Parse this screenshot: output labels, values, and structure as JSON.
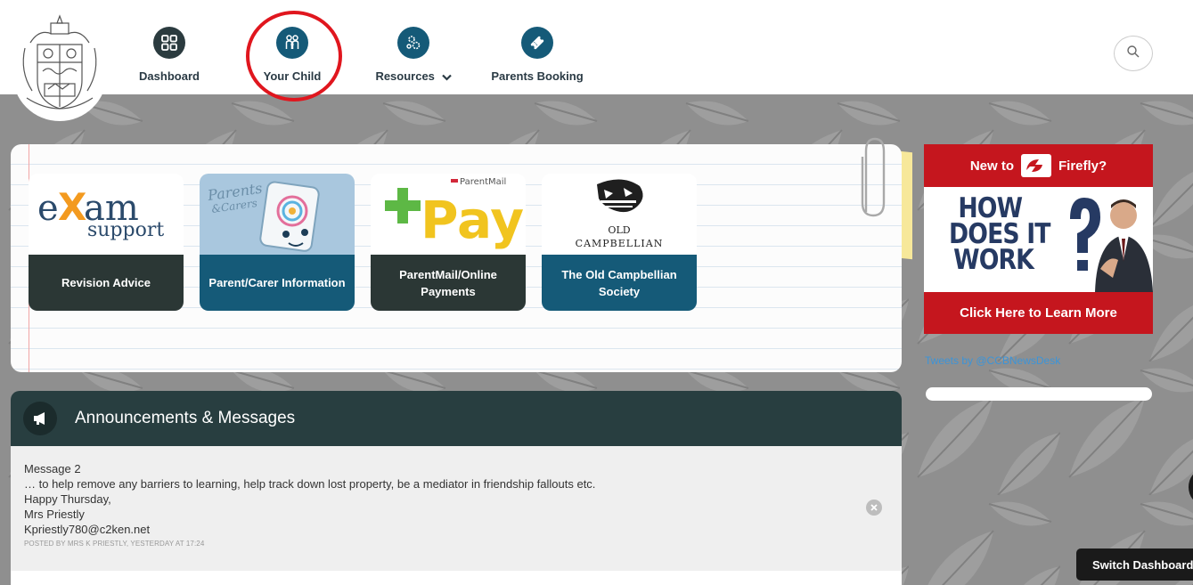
{
  "header": {
    "nav": [
      {
        "label": "Dashboard",
        "icon": "dashboard-grid-icon",
        "color": "#2b3b3f"
      },
      {
        "label": "Your Child",
        "icon": "family-icon",
        "color": "#155a78"
      },
      {
        "label": "Resources",
        "icon": "gears-icon",
        "color": "#155a78",
        "has_dropdown": true
      },
      {
        "label": "Parents Booking",
        "icon": "ticket-icon",
        "color": "#155a78"
      }
    ],
    "search_icon": "search-icon"
  },
  "tiles": [
    {
      "label": "Revision Advice",
      "caption_color": "#2b3735",
      "image_text": [
        "exam",
        "support"
      ]
    },
    {
      "label": "Parent/Carer Information",
      "caption_color": "#155a78",
      "image_text": [
        "Parents",
        "& Carers"
      ]
    },
    {
      "label": "ParentMail/Online Payments",
      "caption_color": "#2b3735",
      "image_text": [
        "ParentMail",
        "Pay"
      ]
    },
    {
      "label": "The Old Campbellian Society",
      "caption_color": "#155a78",
      "image_text": [
        "OLD",
        "CAMPBELLIAN"
      ]
    }
  ],
  "announcements": {
    "title": "Announcements & Messages",
    "message": {
      "lines": [
        "Message 2",
        "… to help remove any barriers to learning, help track down lost property, be a mediator in friendship fallouts etc.",
        "Happy Thursday,",
        "Mrs Priestly",
        "Kpriestly780@c2ken.net"
      ],
      "meta": "POSTED BY MRS K PRIESTLY, YESTERDAY AT 17:24"
    }
  },
  "promo": {
    "top_left": "New to",
    "top_right": "Firefly?",
    "headline": [
      "HOW",
      "DOES IT",
      "WORK"
    ],
    "cta": "Click Here to Learn More",
    "brand_color": "#c5161e"
  },
  "tweets_link": "Tweets by @CCBNewsDesk",
  "switch_dashboard": "Switch Dashboard"
}
